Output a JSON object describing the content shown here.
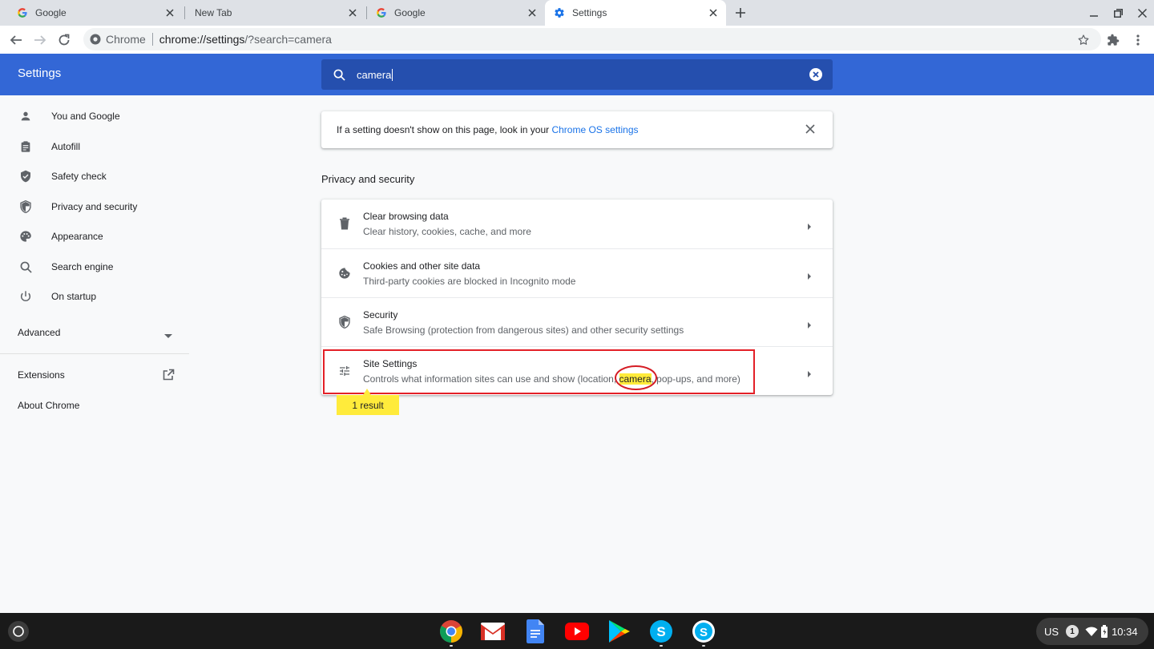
{
  "tabs": [
    {
      "title": "Google",
      "icon": "google-icon"
    },
    {
      "title": "New Tab",
      "icon": "none"
    },
    {
      "title": "Google",
      "icon": "google-icon"
    },
    {
      "title": "Settings",
      "icon": "gear-icon",
      "active": true
    }
  ],
  "toolbar": {
    "site_chip": "Chrome",
    "url_host": "chrome://settings",
    "url_rest": "/?search=camera"
  },
  "header": {
    "title": "Settings",
    "search_value": "camera"
  },
  "sidebar": {
    "items": [
      {
        "label": "You and Google",
        "icon": "person-icon"
      },
      {
        "label": "Autofill",
        "icon": "clipboard-icon"
      },
      {
        "label": "Safety check",
        "icon": "shield-check-icon"
      },
      {
        "label": "Privacy and security",
        "icon": "shield-half-icon"
      },
      {
        "label": "Appearance",
        "icon": "palette-icon"
      },
      {
        "label": "Search engine",
        "icon": "search-icon"
      },
      {
        "label": "On startup",
        "icon": "power-icon"
      }
    ],
    "advanced": "Advanced",
    "extensions": "Extensions",
    "about": "About Chrome"
  },
  "notice": {
    "text": "If a setting doesn't show on this page, look in your ",
    "link": "Chrome OS settings"
  },
  "section_title": "Privacy and security",
  "rows": [
    {
      "title": "Clear browsing data",
      "subtitle": "Clear history, cookies, cache, and more",
      "icon": "trash-icon"
    },
    {
      "title": "Cookies and other site data",
      "subtitle": "Third-party cookies are blocked in Incognito mode",
      "icon": "cookie-icon"
    },
    {
      "title": "Security",
      "subtitle": "Safe Browsing (protection from dangerous sites) and other security settings",
      "icon": "shield-half-icon"
    },
    {
      "title": "Site Settings",
      "subtitle_before": "Controls what information sites can use and show (location, ",
      "subtitle_match": "camera",
      "subtitle_after": ", pop-ups, and more)",
      "icon": "sliders-icon"
    }
  ],
  "result_bubble": "1 result",
  "status": {
    "ime": "US",
    "notifications": "1",
    "time": "10:34"
  },
  "colors": {
    "header_blue": "#3367d6",
    "search_blue": "#254fae",
    "link_blue": "#1a73e8",
    "highlight_yellow": "#ffeb3b",
    "annotation_red": "#e32027"
  }
}
